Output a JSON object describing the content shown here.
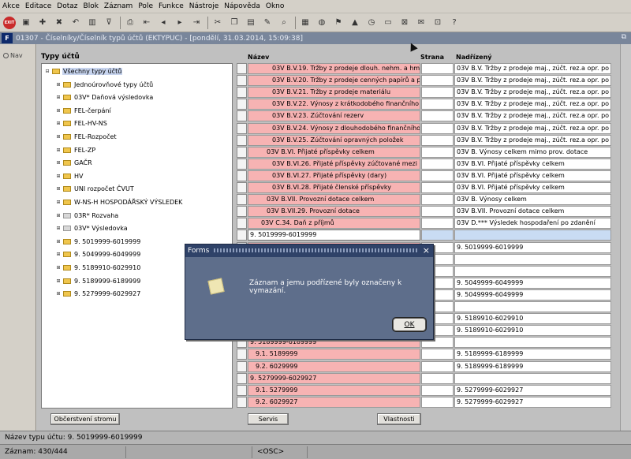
{
  "menu": [
    "Akce",
    "Editace",
    "Dotaz",
    "Blok",
    "Záznam",
    "Pole",
    "Funkce",
    "Nástroje",
    "Nápověda",
    "Okno"
  ],
  "toolbar": {
    "exit_label": "EXIT",
    "icons": [
      "exit-icon",
      "save-icon",
      "new-record-icon",
      "delete-record-icon",
      "undo-icon",
      "block-icon",
      "filter-icon",
      "print-icon",
      "first-record-icon",
      "previous-record-icon",
      "next-record-icon",
      "last-record-icon",
      "cut-icon",
      "copy-icon",
      "paste-icon",
      "edit-icon",
      "find-icon",
      "attachment-icon",
      "globe-icon",
      "flag-icon",
      "triangle-icon",
      "clock-icon",
      "document-icon",
      "excel-icon",
      "mail-icon",
      "stamp-icon",
      "help-icon"
    ]
  },
  "window": {
    "title": "01307 - Číselníky/Číselník typů účtů (EKTYPUC) - [pondělí, 31.03.2014, 15:09:38]",
    "restore_glyph": "⧉"
  },
  "nav_label": "Nav",
  "tree": {
    "heading": "Typy účtů",
    "nodes": [
      {
        "label": "Všechny typy účtů",
        "level": 0,
        "exp": "⊟",
        "kind": "folder",
        "selected": true
      },
      {
        "label": "Jednoúrovňové typy účtů",
        "level": 1,
        "exp": "⊞",
        "kind": "folder"
      },
      {
        "label": "03V* Daňová výsledovka",
        "level": 1,
        "exp": "⊞",
        "kind": "folder"
      },
      {
        "label": "FEL-čerpání",
        "level": 1,
        "exp": "⊞",
        "kind": "folder"
      },
      {
        "label": "FEL-HV-NS",
        "level": 1,
        "exp": "⊞",
        "kind": "folder"
      },
      {
        "label": "FEL-Rozpočet",
        "level": 1,
        "exp": "⊞",
        "kind": "folder"
      },
      {
        "label": "FEL-ZP",
        "level": 1,
        "exp": "⊞",
        "kind": "folder"
      },
      {
        "label": "GAČR",
        "level": 1,
        "exp": "⊞",
        "kind": "folder"
      },
      {
        "label": "HV",
        "level": 1,
        "exp": "⊞",
        "kind": "folder"
      },
      {
        "label": "UNI rozpočet ČVUT",
        "level": 1,
        "exp": "⊞",
        "kind": "folder"
      },
      {
        "label": "W-NS-H HOSPODÁŘSKÝ VÝSLEDEK",
        "level": 1,
        "exp": "⊞",
        "kind": "folder"
      },
      {
        "label": "03R* Rozvaha",
        "level": 1,
        "exp": "⊞",
        "kind": "note"
      },
      {
        "label": "03V* Výsledovka",
        "level": 1,
        "exp": "⊞",
        "kind": "note"
      },
      {
        "label": "9. 5019999-6019999",
        "level": 1,
        "exp": "⊞",
        "kind": "folder"
      },
      {
        "label": "9. 5049999-6049999",
        "level": 1,
        "exp": "⊞",
        "kind": "folder"
      },
      {
        "label": "9. 5189910-6029910",
        "level": 1,
        "exp": "⊞",
        "kind": "folder"
      },
      {
        "label": "9. 5189999-6189999",
        "level": 1,
        "exp": "⊞",
        "kind": "folder"
      },
      {
        "label": "9. 5279999-6029927",
        "level": 1,
        "exp": "⊞",
        "kind": "folder"
      }
    ]
  },
  "columns": {
    "nazev": "Název",
    "strana": "Strana",
    "nadrizeny": "Nadřízený"
  },
  "rows": [
    {
      "nazev": "03V B.V.19. Tržby z prodeje dlouh. nehm. a hmot",
      "nadrizeny": "03V B.V. Tržby z prodeje maj., zúčt. rez.a opr. po",
      "style": "pink",
      "indent": 4
    },
    {
      "nazev": "03V B.V.20. Tržby z prodeje cenných papírů a p",
      "nadrizeny": "03V B.V. Tržby z prodeje maj., zúčt. rez.a opr. po",
      "style": "pink",
      "indent": 4
    },
    {
      "nazev": "03V B.V.21. Tržby z prodeje materiálu",
      "nadrizeny": "03V B.V. Tržby z prodeje maj., zúčt. rez.a opr. po",
      "style": "pink",
      "indent": 4
    },
    {
      "nazev": "03V B.V.22. Výnosy z krátkodobého finančního m",
      "nadrizeny": "03V B.V. Tržby z prodeje maj., zúčt. rez.a opr. po",
      "style": "pink",
      "indent": 4
    },
    {
      "nazev": "03V B.V.23. Zúčtování rezerv",
      "nadrizeny": "03V B.V. Tržby z prodeje maj., zúčt. rez.a opr. po",
      "style": "pink",
      "indent": 4
    },
    {
      "nazev": "03V B.V.24. Výnosy z dlouhodobého finančního m",
      "nadrizeny": "03V B.V. Tržby z prodeje maj., zúčt. rez.a opr. po",
      "style": "pink",
      "indent": 4
    },
    {
      "nazev": "03V B.V.25. Zúčtování opravných položek",
      "nadrizeny": "03V B.V. Tržby z prodeje maj., zúčt. rez.a opr. po",
      "style": "pink",
      "indent": 4
    },
    {
      "nazev": "03V B.VI. Přijaté příspěvky celkem",
      "nadrizeny": "03V B. Výnosy celkem mimo prov. dotace",
      "style": "pink",
      "indent": 3
    },
    {
      "nazev": "03V B.VI.26. Přijaté příspěvky zúčtované mezi org",
      "nadrizeny": "03V B.VI. Přijaté příspěvky celkem",
      "style": "pink",
      "indent": 4
    },
    {
      "nazev": "03V B.VI.27. Přijaté příspěvky (dary)",
      "nadrizeny": "03V B.VI. Přijaté příspěvky celkem",
      "style": "pink",
      "indent": 4
    },
    {
      "nazev": "03V B.VI.28. Přijaté členské příspěvky",
      "nadrizeny": "03V B.VI. Přijaté příspěvky celkem",
      "style": "pink",
      "indent": 4
    },
    {
      "nazev": "03V B.VII. Provozní dotace celkem",
      "nadrizeny": "03V B. Výnosy celkem",
      "style": "pink",
      "indent": 3
    },
    {
      "nazev": "03V B.VII.29. Provozní dotace",
      "nadrizeny": "03V B.VII. Provozní dotace celkem",
      "style": "pink",
      "indent": 3
    },
    {
      "nazev": "03V C.34. Daň z příjmů",
      "nadrizeny": "03V D.*** Výsledek hospodaření po zdanění",
      "style": "pink",
      "indent": 2
    },
    {
      "nazev": "9. 5019999-6019999",
      "nadrizeny": "",
      "style": "current",
      "indent": 0
    },
    {
      "nazev": "",
      "nadrizeny": "9. 5019999-6019999",
      "style": "pink",
      "indent": 1
    },
    {
      "nazev": "",
      "nadrizeny": "",
      "style": "pink",
      "indent": 1
    },
    {
      "nazev": "",
      "nadrizeny": "",
      "style": "white",
      "indent": 0
    },
    {
      "nazev": "",
      "nadrizeny": "9. 5049999-6049999",
      "style": "pink",
      "indent": 1
    },
    {
      "nazev": "",
      "nadrizeny": "9. 5049999-6049999",
      "style": "pink",
      "indent": 1
    },
    {
      "nazev": "",
      "nadrizeny": "",
      "style": "white",
      "indent": 0
    },
    {
      "nazev": "",
      "nadrizeny": "9. 5189910-6029910",
      "style": "pink",
      "indent": 1
    },
    {
      "nazev": "",
      "nadrizeny": "9. 5189910-6029910",
      "style": "pink",
      "indent": 1
    },
    {
      "nazev": "9. 5189999-6189999",
      "nadrizeny": "",
      "style": "pink",
      "indent": 0
    },
    {
      "nazev": "9.1. 5189999",
      "nadrizeny": "9. 5189999-6189999",
      "style": "pink",
      "indent": 1
    },
    {
      "nazev": "9.2. 6029999",
      "nadrizeny": "9. 5189999-6189999",
      "style": "pink",
      "indent": 1
    },
    {
      "nazev": "9. 5279999-6029927",
      "nadrizeny": "",
      "style": "pink",
      "indent": 0
    },
    {
      "nazev": "9.1. 5279999",
      "nadrizeny": "9. 5279999-6029927",
      "style": "pink",
      "indent": 1
    },
    {
      "nazev": "9.2. 6029927",
      "nadrizeny": "9. 5279999-6029927",
      "style": "pink",
      "indent": 1
    }
  ],
  "buttons": {
    "refresh_tree": "Občerstvení stromu",
    "servis": "Servis",
    "vlastnosti": "Vlastnosti"
  },
  "status": {
    "line1": "Název typu účtu: 9. 5019999-6019999",
    "records": "Záznam: 430/444",
    "osc": "<OSC>"
  },
  "dialog": {
    "title": "Forms",
    "close_glyph": "×",
    "message": "Záznam a jemu podřízené byly označeny k vymazání.",
    "ok_label": "OK"
  }
}
